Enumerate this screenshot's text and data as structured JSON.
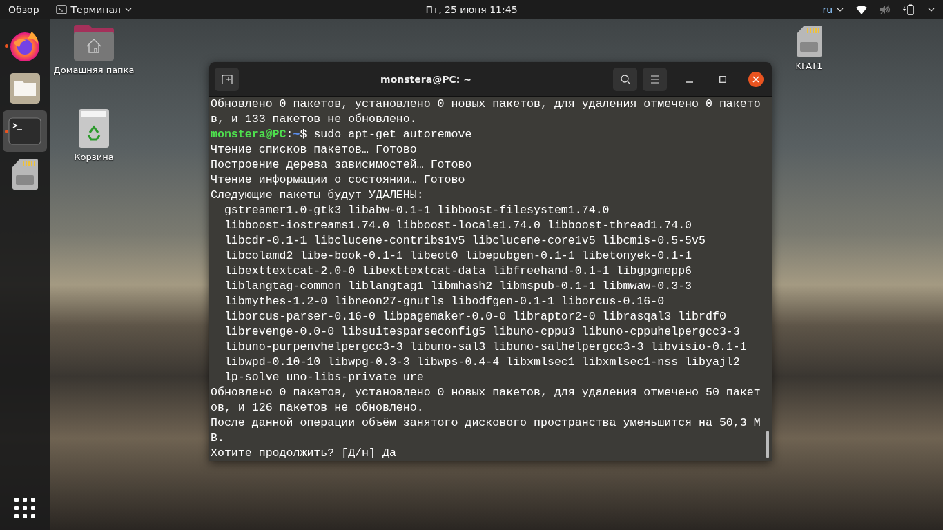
{
  "top_bar": {
    "activities": "Обзор",
    "app_menu": "Терминал",
    "clock": "Пт, 25 июня  11:45",
    "keyboard_layout": "ru"
  },
  "dock": {
    "items": [
      {
        "kind": "browser",
        "running": true,
        "selected": false
      },
      {
        "kind": "files",
        "running": false,
        "selected": false
      },
      {
        "kind": "terminal",
        "running": true,
        "selected": true
      },
      {
        "kind": "card",
        "running": false,
        "selected": false
      }
    ]
  },
  "desktop_icons": [
    {
      "kind": "home",
      "label": "Домашняя папка"
    },
    {
      "kind": "trash",
      "label": "Корзина"
    },
    {
      "kind": "card",
      "label": "KFAT1"
    }
  ],
  "terminal": {
    "title": "monstera@PC: ~",
    "lines": [
      {
        "kind": "output",
        "text": "Обновлено 0 пакетов, установлено 0 новых пакетов, для удаления отмечено 0 пакето"
      },
      {
        "kind": "output",
        "text": "в, и 133 пакетов не обновлено."
      },
      {
        "kind": "prompt",
        "user": "monstera@PC",
        "separator": ":",
        "path": "~",
        "command": "$ sudo apt-get autoremove"
      },
      {
        "kind": "output",
        "text": "Чтение списков пакетов… Готово"
      },
      {
        "kind": "output",
        "text": "Построение дерева зависимостей… Готово"
      },
      {
        "kind": "output",
        "text": "Чтение информации о состоянии… Готово"
      },
      {
        "kind": "output",
        "text": "Следующие пакеты будут УДАЛЕНЫ:"
      },
      {
        "kind": "output",
        "text": "  gstreamer1.0-gtk3 libabw-0.1-1 libboost-filesystem1.74.0"
      },
      {
        "kind": "output",
        "text": "  libboost-iostreams1.74.0 libboost-locale1.74.0 libboost-thread1.74.0"
      },
      {
        "kind": "output",
        "text": "  libcdr-0.1-1 libclucene-contribs1v5 libclucene-core1v5 libcmis-0.5-5v5"
      },
      {
        "kind": "output",
        "text": "  libcolamd2 libe-book-0.1-1 libeot0 libepubgen-0.1-1 libetonyek-0.1-1"
      },
      {
        "kind": "output",
        "text": "  libexttextcat-2.0-0 libexttextcat-data libfreehand-0.1-1 libgpgmepp6"
      },
      {
        "kind": "output",
        "text": "  liblangtag-common liblangtag1 libmhash2 libmspub-0.1-1 libmwaw-0.3-3"
      },
      {
        "kind": "output",
        "text": "  libmythes-1.2-0 libneon27-gnutls libodfgen-0.1-1 liborcus-0.16-0"
      },
      {
        "kind": "output",
        "text": "  liborcus-parser-0.16-0 libpagemaker-0.0-0 libraptor2-0 librasqal3 librdf0"
      },
      {
        "kind": "output",
        "text": "  librevenge-0.0-0 libsuitesparseconfig5 libuno-cppu3 libuno-cppuhelpergcc3-3"
      },
      {
        "kind": "output",
        "text": "  libuno-purpenvhelpergcc3-3 libuno-sal3 libuno-salhelpergcc3-3 libvisio-0.1-1"
      },
      {
        "kind": "output",
        "text": "  libwpd-0.10-10 libwpg-0.3-3 libwps-0.4-4 libxmlsec1 libxmlsec1-nss libyajl2"
      },
      {
        "kind": "output",
        "text": "  lp-solve uno-libs-private ure"
      },
      {
        "kind": "output",
        "text": "Обновлено 0 пакетов, установлено 0 новых пакетов, для удаления отмечено 50 пакет"
      },
      {
        "kind": "output",
        "text": "ов, и 126 пакетов не обновлено."
      },
      {
        "kind": "output",
        "text": "После данной операции объём занятого дискового пространства уменьшится на 50,3 M"
      },
      {
        "kind": "output",
        "text": "B."
      },
      {
        "kind": "output",
        "text": "Хотите продолжить? [Д/н] Да"
      }
    ]
  }
}
